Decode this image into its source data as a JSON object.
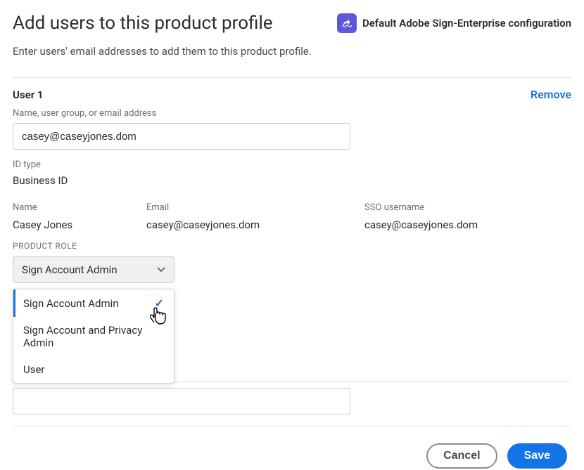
{
  "header": {
    "title": "Add users to this product profile",
    "profile_name": "Default Adobe Sign-Enterprise configuration",
    "subtitle": "Enter users' email addresses to add them to this product profile."
  },
  "user1": {
    "section_label": "User 1",
    "remove_label": "Remove",
    "input_label": "Name, user group, or email address",
    "input_value": "casey@caseyjones.dom",
    "id_type_label": "ID type",
    "id_type_value": "Business ID",
    "name_label": "Name",
    "name_value": "Casey Jones",
    "email_label": "Email",
    "email_value": "casey@caseyjones.dom",
    "sso_label": "SSO username",
    "sso_value": "casey@caseyjones.dom",
    "product_role_label": "PRODUCT ROLE",
    "selected_role": "Sign Account Admin",
    "role_options": [
      "Sign Account Admin",
      "Sign Account and Privacy Admin",
      "User"
    ]
  },
  "user2": {
    "input_value": ""
  },
  "footer": {
    "cancel_label": "Cancel",
    "save_label": "Save"
  }
}
